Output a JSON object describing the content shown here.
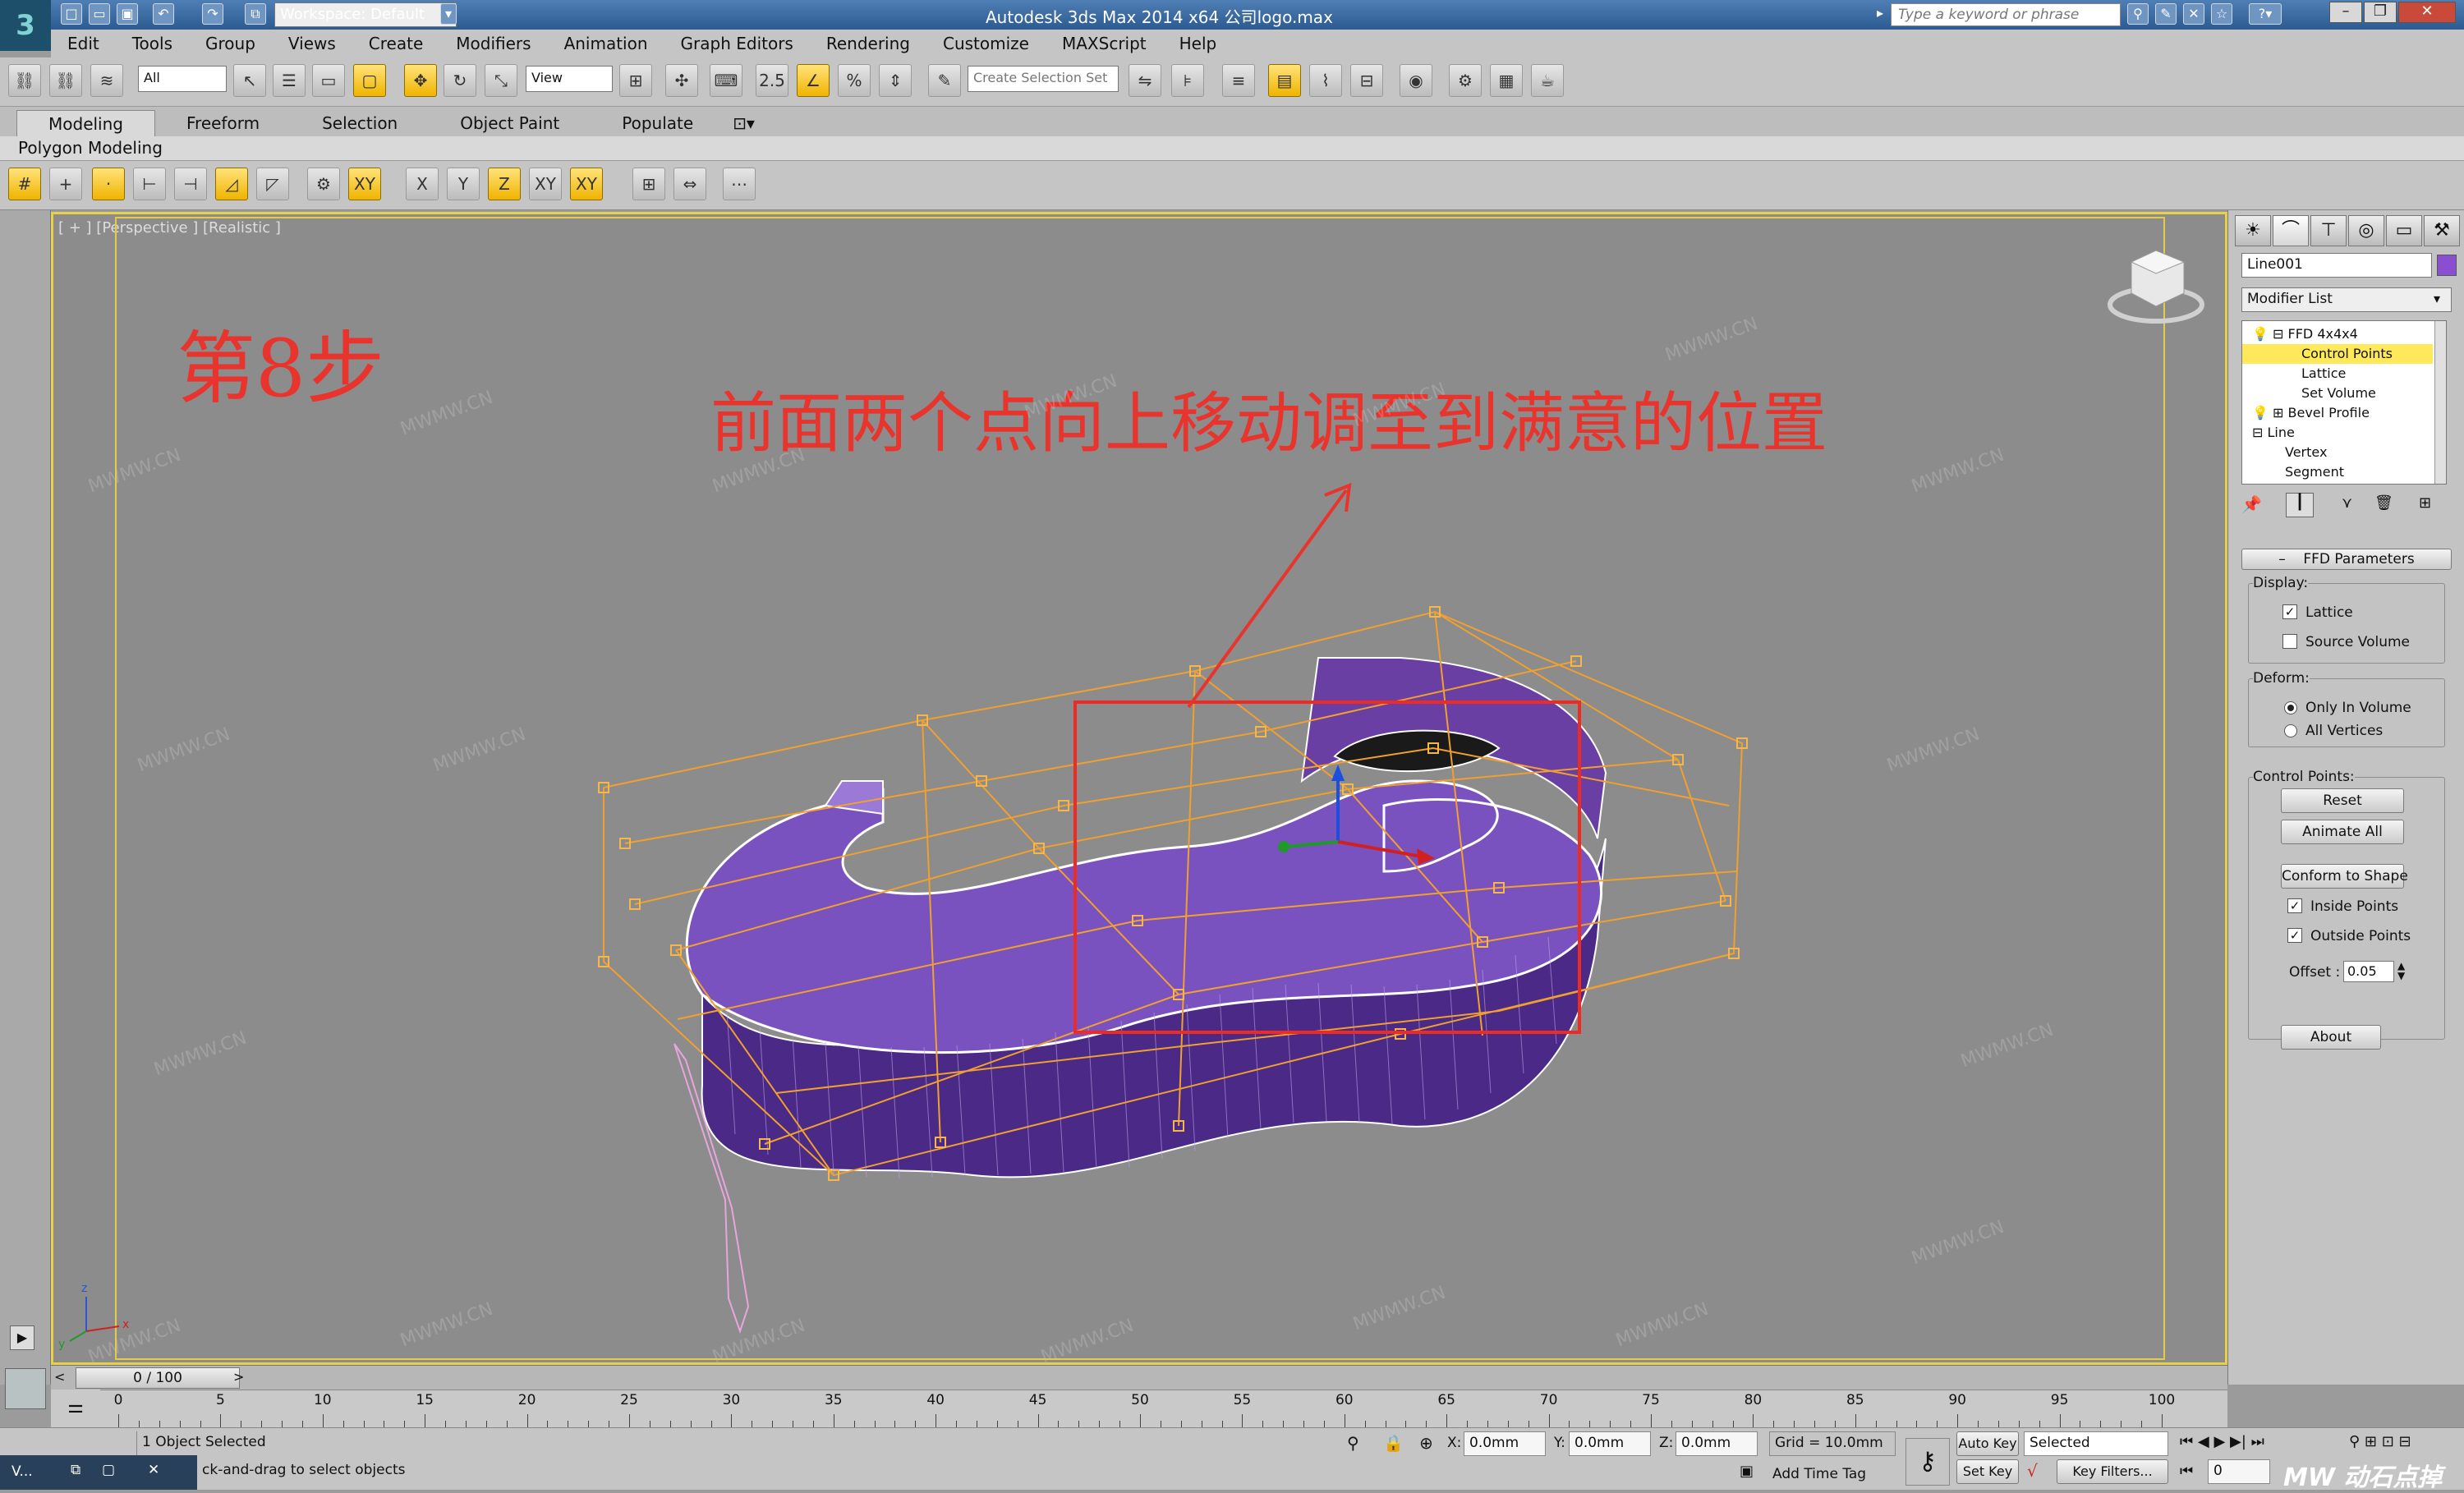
{
  "title_bar": {
    "title": "Autodesk 3ds Max  2014 x64       公司logo.max",
    "workspace": "Workspace: Default",
    "search_placeholder": "Type a keyword or phrase",
    "logo": "3"
  },
  "menu": [
    "Edit",
    "Tools",
    "Group",
    "Views",
    "Create",
    "Modifiers",
    "Animation",
    "Graph Editors",
    "Rendering",
    "Customize",
    "MAXScript",
    "Help"
  ],
  "toolbar": {
    "filter": "All",
    "coord": "View",
    "spinner_snap": "2.5",
    "selection_set": "Create Selection Set"
  },
  "ribbon": {
    "tabs": [
      "Modeling",
      "Freeform",
      "Selection",
      "Object Paint",
      "Populate"
    ],
    "active_tab": "Modeling",
    "panel_label": "Polygon Modeling"
  },
  "snap_toolbar": {
    "axes": [
      "X",
      "Y",
      "Z",
      "XY",
      "XY"
    ]
  },
  "viewport": {
    "label": "[ + ] [Perspective ] [Realistic ]",
    "step": "第8步",
    "instruction": "前面两个点向上移动调至到满意的位置",
    "watermark": "MWMW.CN",
    "annotation_color": "#e8342c",
    "object_color": "#6a3fa3",
    "lattice_color": "#f0a030",
    "gizmo_axes": {
      "x": "x",
      "y": "y",
      "z": "z"
    }
  },
  "command_panel": {
    "object_name": "Line001",
    "object_color": "#8a4fd0",
    "modifier_list": "Modifier List",
    "stack": [
      {
        "label": "FFD 4x4x4",
        "level": 0,
        "selected": false
      },
      {
        "label": "Control Points",
        "level": 1,
        "selected": true
      },
      {
        "label": "Lattice",
        "level": 1,
        "selected": false
      },
      {
        "label": "Set Volume",
        "level": 1,
        "selected": false
      },
      {
        "label": "Bevel Profile",
        "level": 0,
        "selected": false
      },
      {
        "label": "Line",
        "level": 0,
        "selected": false
      },
      {
        "label": "Vertex",
        "level": 1,
        "selected": false
      },
      {
        "label": "Segment",
        "level": 1,
        "selected": false
      }
    ],
    "rollout": "FFD Parameters",
    "display_label": "Display:",
    "lattice": "Lattice",
    "source_volume": "Source Volume",
    "deform_label": "Deform:",
    "only_in_volume": "Only In Volume",
    "all_vertices": "All Vertices",
    "cp_label": "Control Points:",
    "reset": "Reset",
    "animate_all": "Animate All",
    "conform": "Conform to Shape",
    "inside_points": "Inside Points",
    "outside_points": "Outside Points",
    "offset_label": "Offset :",
    "offset_value": "0.05",
    "about": "About"
  },
  "timeline": {
    "frame": "0 / 100",
    "ticks": [
      0,
      5,
      10,
      15,
      20,
      25,
      30,
      35,
      40,
      45,
      50,
      55,
      60,
      65,
      70,
      75,
      80,
      85,
      90,
      95,
      100
    ]
  },
  "status": {
    "selected": "1 Object Selected",
    "prompt": "ck-and-drag to select objects",
    "x": "0.0mm",
    "y": "0.0mm",
    "z": "0.0mm",
    "grid": "Grid = 10.0mm",
    "auto_key": "Auto Key",
    "set_key": "Set Key",
    "key_mode": "Selected",
    "key_filters": "Key Filters...",
    "add_time_tag": "Add Time Tag",
    "frame_field": "0",
    "taskbar_label": "V...",
    "brand": "MW 动石点掉"
  }
}
